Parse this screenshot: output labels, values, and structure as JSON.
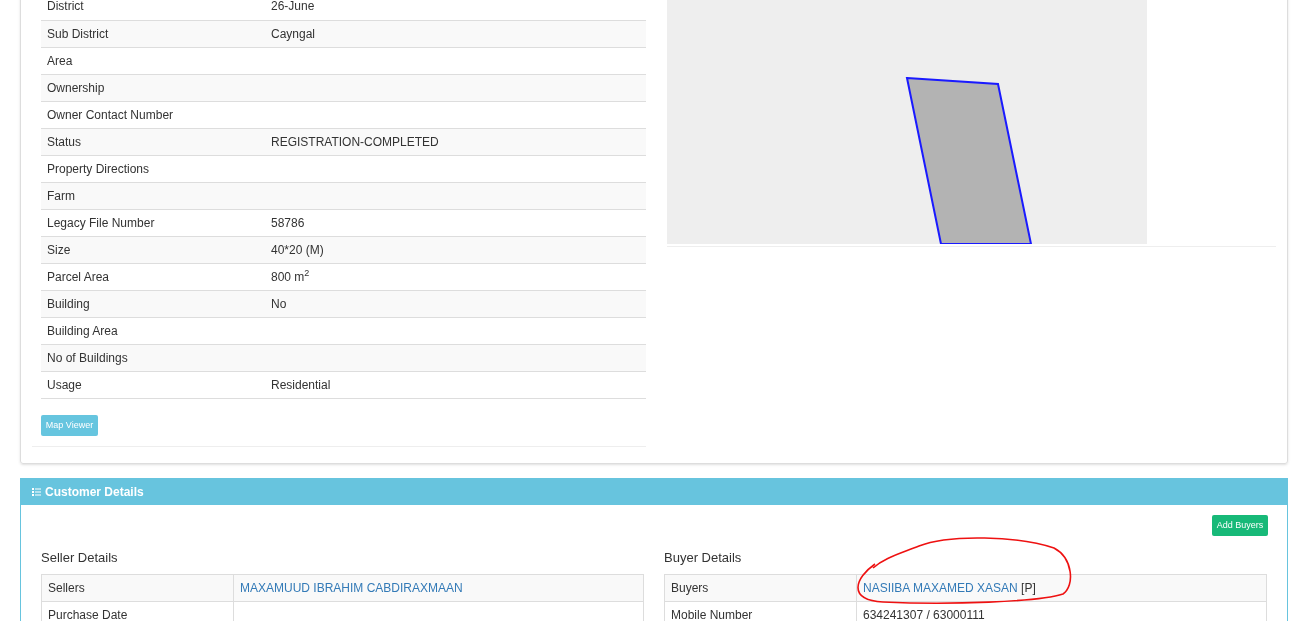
{
  "property_details": {
    "rows": [
      {
        "label": "District",
        "value": "26-June"
      },
      {
        "label": "Sub District",
        "value": "Cayngal"
      },
      {
        "label": "Area",
        "value": ""
      },
      {
        "label": "Ownership",
        "value": ""
      },
      {
        "label": "Owner Contact Number",
        "value": ""
      },
      {
        "label": "Status",
        "value": "REGISTRATION-COMPLETED"
      },
      {
        "label": "Property Directions",
        "value": ""
      },
      {
        "label": "Farm",
        "value": ""
      },
      {
        "label": "Legacy File Number",
        "value": "58786"
      },
      {
        "label": "Size",
        "value": "40*20 (M)"
      },
      {
        "label": "Parcel Area",
        "value": "800 m$^{2}$"
      },
      {
        "label": "Building",
        "value": "No"
      },
      {
        "label": "Building Area",
        "value": ""
      },
      {
        "label": "No of Buildings",
        "value": ""
      },
      {
        "label": "Usage",
        "value": "Residential"
      }
    ],
    "map_viewer_button": "Map Viewer"
  },
  "customer_details": {
    "title": "Customer Details",
    "add_buyers_button": "Add Buyers",
    "seller": {
      "heading": "Seller Details",
      "rows": [
        {
          "label": "Sellers",
          "value": "MAXAMUUD IBRAHIM CABDIRAXMAAN",
          "kind": "link"
        },
        {
          "label": "Purchase Date",
          "value": "",
          "kind": "text"
        }
      ]
    },
    "buyer": {
      "heading": "Buyer Details",
      "rows": [
        {
          "label": "Buyers",
          "value": "NASIIBA MAXAMED XASAN",
          "suffix": "[P]",
          "kind": "link"
        },
        {
          "label": "Mobile Number",
          "value": "634241307 / 63000111",
          "kind": "text"
        }
      ]
    }
  }
}
